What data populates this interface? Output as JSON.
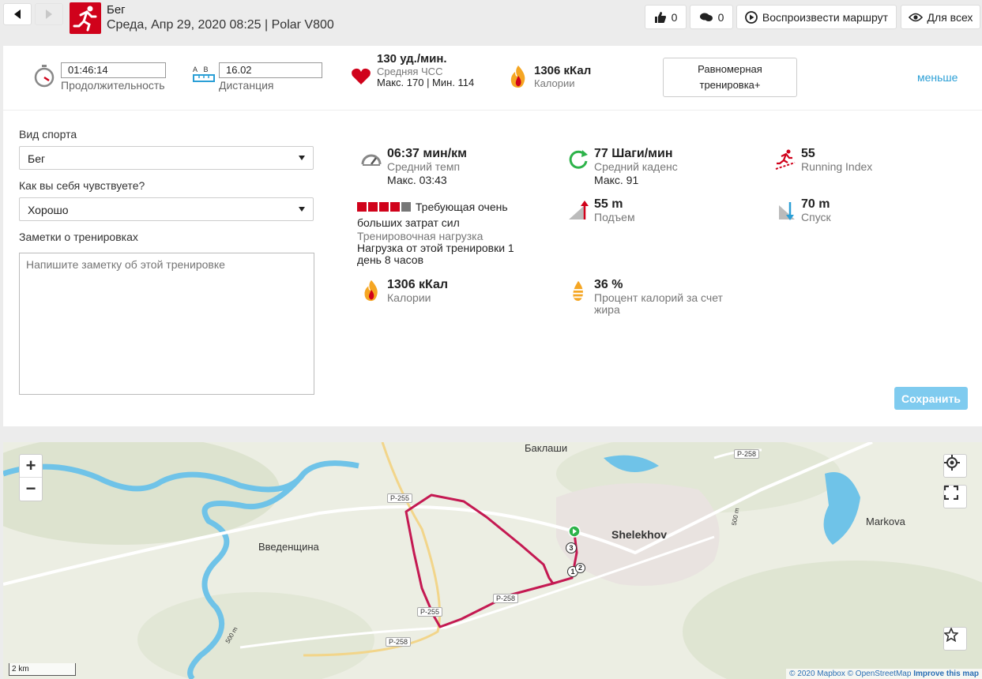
{
  "header": {
    "sport_name": "Бег",
    "subtitle": "Среда, Апр 29, 2020 08:25 | Polar V800",
    "likes": "0",
    "comments": "0",
    "play_route_label": "Воспроизвести маршрут",
    "visibility_label": "Для всех",
    "accent_color": "#d0021b"
  },
  "summary": {
    "duration_value": "01:46:14",
    "duration_label": "Продолжительность",
    "distance_ab_a": "A",
    "distance_ab_b": "B",
    "distance_value": "16.02",
    "distance_label": "Дистанция",
    "hr_value": "130 уд./мин.",
    "hr_label": "Средняя ЧСС",
    "hr_detail": "Макс. 170  |  Мин. 114",
    "calories_value": "1306 кКал",
    "calories_label": "Калории",
    "training_benefit": "Равномерная тренировка+",
    "less_link": "меньше"
  },
  "form": {
    "sport_label": "Вид спорта",
    "sport_value": "Бег",
    "feeling_label": "Как вы себя чувствуете?",
    "feeling_value": "Хорошо",
    "notes_label": "Заметки о тренировках",
    "notes_placeholder": "Напишите заметку об этой тренировке",
    "save_label": "Сохранить"
  },
  "stats": {
    "pace_value": "06:37 мин/км",
    "pace_label": "Средний темп",
    "pace_max": "Макс. 03:43",
    "cadence_value": "77 Шаги/мин",
    "cadence_label": "Средний каденс",
    "cadence_max": "Макс. 91",
    "running_index_value": "55",
    "running_index_label": "Running Index",
    "load_title": "Требующая очень больших затрат сил",
    "load_label": "Тренировочная нагрузка",
    "load_desc": "Нагрузка от этой тренировки 1 день 8 часов",
    "load_level": 4,
    "load_max": 5,
    "ascent_value": "55 m",
    "ascent_label": "Подъем",
    "descent_value": "70 m",
    "descent_label": "Спуск",
    "calories_value": "1306 кКал",
    "calories_label": "Калории",
    "fat_value": "36 %",
    "fat_label": "Процент калорий за счет жира"
  },
  "map": {
    "labels": {
      "baklashi": "Баклаши",
      "shelekhov": "Shelekhov",
      "vvedenshchina": "Введенщина",
      "markova": "Markova",
      "contour_500_a": "500 m",
      "contour_500_b": "500 m"
    },
    "roads": {
      "p258_top": "Р-258",
      "p255_top": "Р-255",
      "p255_mid": "Р-255",
      "p258_bottom": "Р-258",
      "p258_mid": "Р-258"
    },
    "markers": {
      "m1": "1",
      "m2": "2",
      "m3": "3"
    },
    "scale_label": "2 km",
    "attribution_a": "© 2020 Mapbox",
    "attribution_b": "© OpenStreetMap",
    "attribution_c": "Improve this map",
    "zoom_in": "+",
    "zoom_out": "−"
  }
}
